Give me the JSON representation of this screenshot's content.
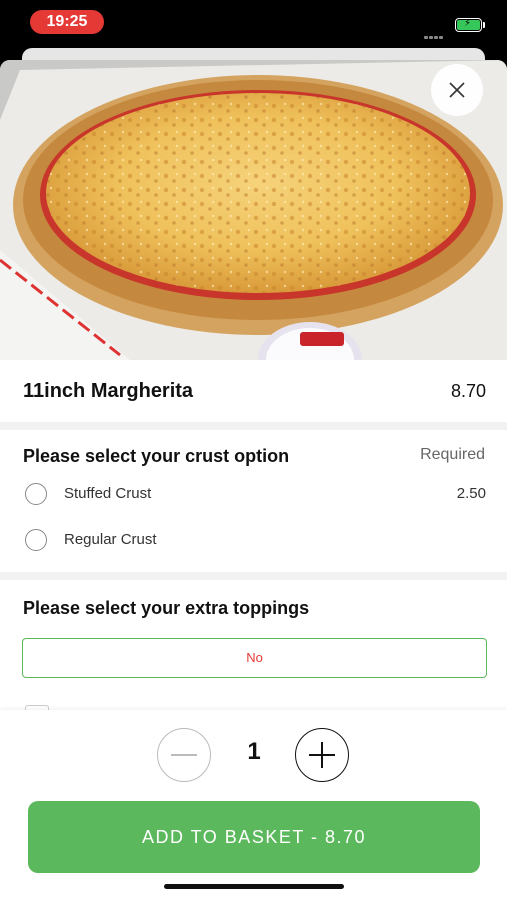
{
  "status_bar": {
    "time": "19:25"
  },
  "item": {
    "title": "11inch Margherita",
    "price": "8.70"
  },
  "crust_section": {
    "title": "Please select your crust option",
    "required_label": "Required",
    "options": [
      {
        "label": "Stuffed Crust",
        "price": "2.50"
      },
      {
        "label": "Regular Crust",
        "price": ""
      }
    ]
  },
  "toppings_section": {
    "title": "Please select your extra toppings",
    "no_label": "No"
  },
  "quantity": {
    "value": "1"
  },
  "add_button": {
    "label": "ADD TO BASKET  -  8.70"
  },
  "colors": {
    "accent_green": "#5cb85c",
    "time_pill": "#e53935",
    "no_text": "#e53935"
  },
  "icons": {
    "close": "close-icon",
    "minus": "minus-icon",
    "plus": "plus-icon",
    "battery": "battery-charging-icon"
  }
}
